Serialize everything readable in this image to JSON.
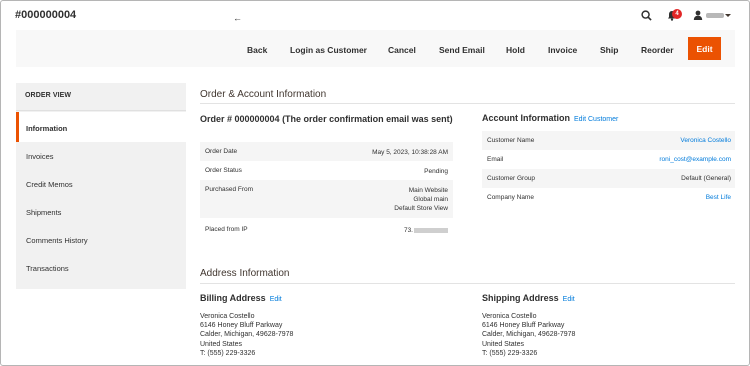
{
  "header": {
    "title": "#000000004",
    "notification_count": "4",
    "icons": [
      "search-icon",
      "bell-icon",
      "user-icon"
    ]
  },
  "actions": {
    "back": "Back",
    "login_as_customer": "Login as Customer",
    "cancel": "Cancel",
    "send_email": "Send Email",
    "hold": "Hold",
    "invoice": "Invoice",
    "ship": "Ship",
    "reorder": "Reorder",
    "edit": "Edit"
  },
  "sidebar": {
    "heading": "ORDER VIEW",
    "items": [
      {
        "label": "Information",
        "active": true
      },
      {
        "label": "Invoices"
      },
      {
        "label": "Credit Memos"
      },
      {
        "label": "Shipments"
      },
      {
        "label": "Comments History"
      },
      {
        "label": "Transactions"
      }
    ]
  },
  "order_account": {
    "section_title": "Order & Account Information",
    "order_heading": "Order # 000000004 (The order confirmation email was sent)",
    "rows": [
      {
        "label": "Order Date",
        "value": "May 5, 2023, 10:38:28 AM"
      },
      {
        "label": "Order Status",
        "value": "Pending"
      },
      {
        "label": "Purchased From",
        "value_lines": [
          "Main Website",
          "Global main",
          "Default Store View"
        ]
      },
      {
        "label": "Placed from IP",
        "value": "73."
      }
    ]
  },
  "account_info": {
    "heading": "Account Information",
    "edit_link": "Edit Customer",
    "rows": [
      {
        "label": "Customer Name",
        "value": "Veronica Costello"
      },
      {
        "label": "Email",
        "value": "roni_cost@example.com"
      },
      {
        "label": "Customer Group",
        "value": "Default (General)"
      },
      {
        "label": "Company Name",
        "value": "Best Life"
      }
    ]
  },
  "address_info": {
    "section_title": "Address Information",
    "billing": {
      "heading": "Billing Address",
      "edit_link": "Edit",
      "lines": [
        "Veronica Costello",
        "6146 Honey Bluff Parkway",
        "Calder, Michigan, 49628-7978",
        "United States",
        "T: (555) 229-3326"
      ]
    },
    "shipping": {
      "heading": "Shipping Address",
      "edit_link": "Edit",
      "lines": [
        "Veronica Costello",
        "6146 Honey Bluff Parkway",
        "Calder, Michigan, 49628-7978",
        "United States",
        "T: (555) 229-3326"
      ]
    }
  },
  "colors": {
    "accent": "#eb5202",
    "link": "#007bdb",
    "badge": "#e22626"
  }
}
